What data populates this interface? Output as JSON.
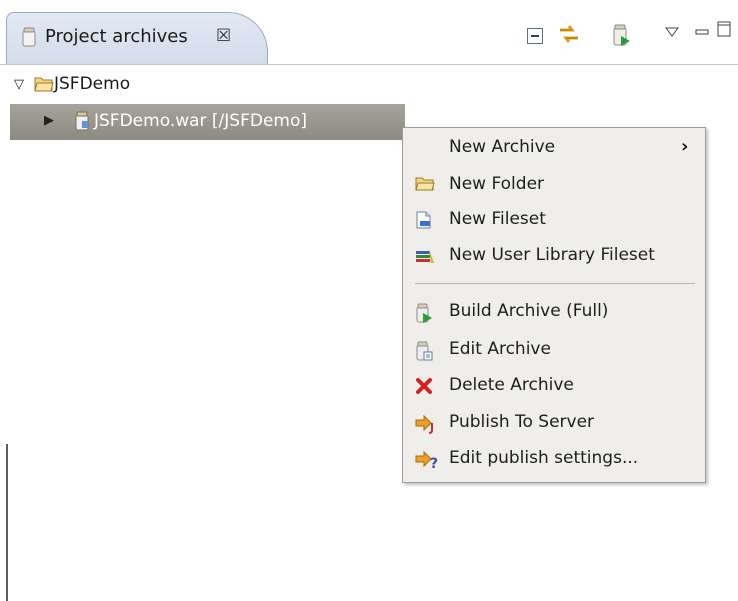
{
  "view": {
    "tab_title": "Project archives",
    "tab_close": "☒",
    "tab_icon": "archive-jar-icon",
    "toolbar": [
      "collapse-all-icon",
      "link-with-editor-icon",
      "build-archive-icon",
      "view-menu-icon",
      "minimize-icon",
      "maximize-icon"
    ]
  },
  "tree": {
    "root": {
      "twisty": "▽",
      "icon": "project-folder-icon",
      "label": "JSFDemo"
    },
    "child": {
      "twisty": "▶",
      "icon": "war-archive-icon",
      "label": "JSFDemo.war [/JSFDemo]",
      "selected": true
    }
  },
  "context_menu": {
    "items": [
      {
        "label": "New Archive",
        "icon": "",
        "submenu_arrow": "›"
      },
      {
        "label": "New Folder",
        "icon": "folder-icon"
      },
      {
        "label": "New Fileset",
        "icon": "fileset-icon"
      },
      {
        "label": "New User Library Fileset",
        "icon": "user-library-icon"
      },
      {
        "label": "Build Archive (Full)",
        "icon": "build-archive-icon"
      },
      {
        "label": "Edit Archive",
        "icon": "edit-archive-icon"
      },
      {
        "label": "Delete Archive",
        "icon": "delete-icon"
      },
      {
        "label": "Publish To Server",
        "icon": "publish-icon"
      },
      {
        "label": "Edit publish settings...",
        "icon": "publish-settings-icon"
      }
    ]
  },
  "colors": {
    "selection": "#9a978f",
    "tab_bg": "#dbe3f0",
    "menu_bg": "#efeeea",
    "delete_red": "#d42020",
    "publish_orange": "#f0a020"
  }
}
